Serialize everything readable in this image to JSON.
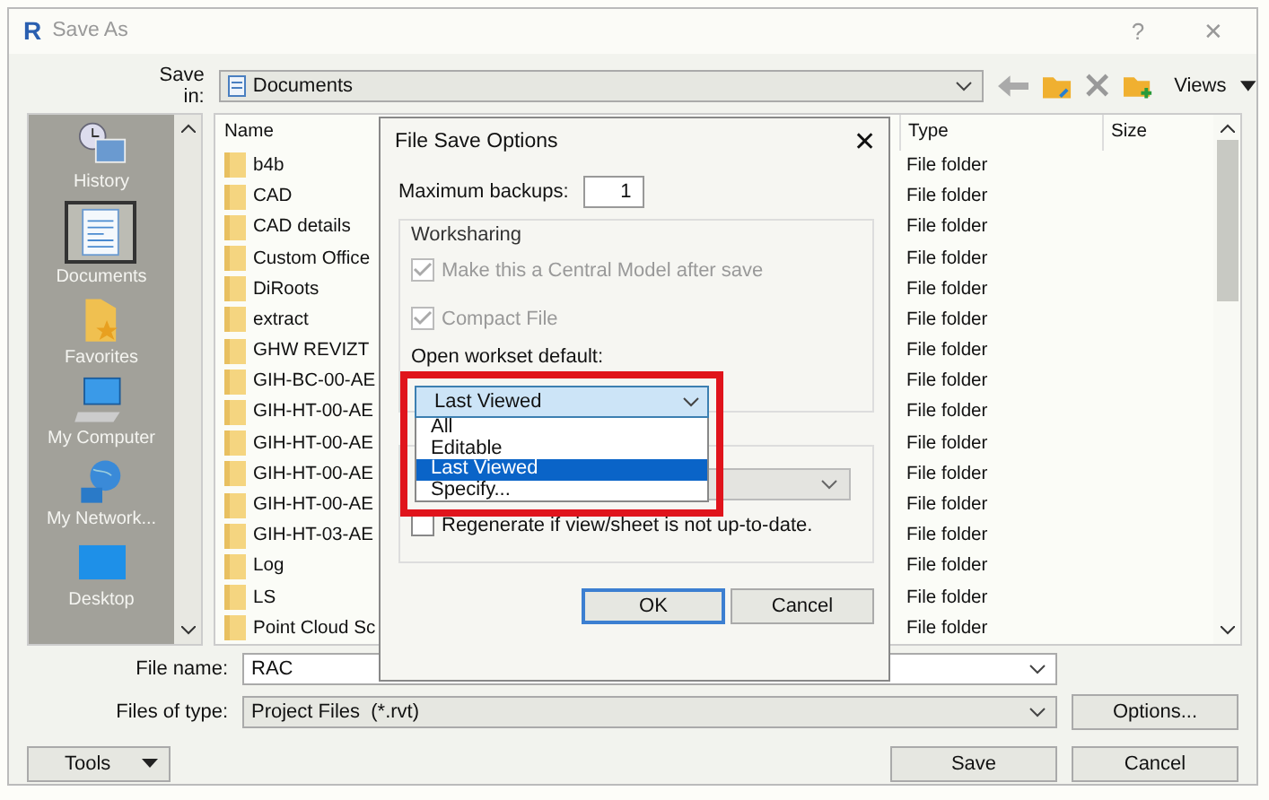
{
  "window": {
    "app_letter": "R",
    "title": "Save As",
    "help": "?",
    "close": "✕"
  },
  "save_in": {
    "label": "Save in:",
    "value": "Documents"
  },
  "toolbar": {
    "views": "Views"
  },
  "places": [
    {
      "label": "History",
      "kind": "history",
      "selected": false
    },
    {
      "label": "Documents",
      "kind": "documents",
      "selected": true
    },
    {
      "label": "Favorites",
      "kind": "favorites",
      "selected": false
    },
    {
      "label": "My Computer",
      "kind": "computer",
      "selected": false
    },
    {
      "label": "My Network...",
      "kind": "network",
      "selected": false
    },
    {
      "label": "Desktop",
      "kind": "desktop",
      "selected": false
    }
  ],
  "file_list": {
    "columns": [
      "Name",
      "Type",
      "Size"
    ],
    "rows": [
      {
        "name": "b4b",
        "type": "File folder"
      },
      {
        "name": "CAD",
        "type": "File folder"
      },
      {
        "name": "CAD details",
        "type": "File folder"
      },
      {
        "name": "Custom Office",
        "type": "File folder"
      },
      {
        "name": "DiRoots",
        "type": "File folder"
      },
      {
        "name": "extract",
        "type": "File folder"
      },
      {
        "name": "GHW REVIZT",
        "type": "File folder"
      },
      {
        "name": "GIH-BC-00-AE",
        "type": "File folder"
      },
      {
        "name": "GIH-HT-00-AE",
        "type": "File folder"
      },
      {
        "name": "GIH-HT-00-AE",
        "type": "File folder"
      },
      {
        "name": "GIH-HT-00-AE",
        "type": "File folder"
      },
      {
        "name": "GIH-HT-00-AE",
        "type": "File folder"
      },
      {
        "name": "GIH-HT-03-AE",
        "type": "File folder"
      },
      {
        "name": "Log",
        "type": "File folder"
      },
      {
        "name": "LS",
        "type": "File folder"
      },
      {
        "name": "Point Cloud Sc",
        "type": "File folder"
      }
    ]
  },
  "file_name": {
    "label": "File name:",
    "value": "RAC"
  },
  "file_type": {
    "label": "Files of type:",
    "value": "Project Files  (*.rvt)"
  },
  "buttons": {
    "tools": "Tools",
    "options": "Options...",
    "save": "Save",
    "cancel": "Cancel"
  },
  "options_dialog": {
    "title": "File Save Options",
    "close": "✕",
    "max_backups": {
      "label": "Maximum backups:",
      "value": "1"
    },
    "worksharing": {
      "title": "Worksharing",
      "checks": [
        {
          "label": "Make this a Central Model after save",
          "checked": true,
          "disabled": true
        },
        {
          "label": "Compact File",
          "checked": true,
          "disabled": true
        }
      ],
      "workset_label": "Open workset default:",
      "workset": {
        "value": "Last Viewed",
        "highlighted": true,
        "options": [
          {
            "label": "All",
            "selected": false
          },
          {
            "label": "Editable",
            "selected": false
          },
          {
            "label": "Last Viewed",
            "selected": true
          },
          {
            "label": "Specify...",
            "selected": false
          }
        ]
      }
    },
    "regenerate": {
      "label": "Regenerate if view/sheet is not up-to-date.",
      "checked": false
    },
    "buttons": [
      "OK",
      "Cancel"
    ]
  }
}
